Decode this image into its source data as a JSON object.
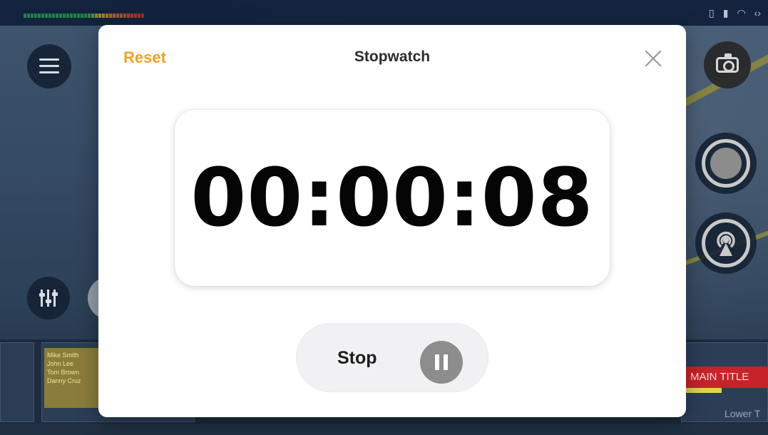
{
  "modal": {
    "reset_label": "Reset",
    "title": "Stopwatch",
    "elapsed_time": "00:00:08",
    "stop_label": "Stop"
  },
  "background": {
    "lineup": [
      "Mike Smith",
      "John Lee",
      "Tom Brown",
      "Danny Cruz"
    ],
    "main_title": "MAIN TITLE",
    "lower_label": "Lower T"
  },
  "colors": {
    "accent": "#f0a224",
    "pause_fill": "#8d8d8d"
  },
  "icons": {
    "menu": "hamburger-icon",
    "mixer": "sliders-icon",
    "camera": "camera-icon",
    "record": "record-icon",
    "stream": "broadcast-icon",
    "close": "close-icon",
    "pause": "pause-icon"
  }
}
